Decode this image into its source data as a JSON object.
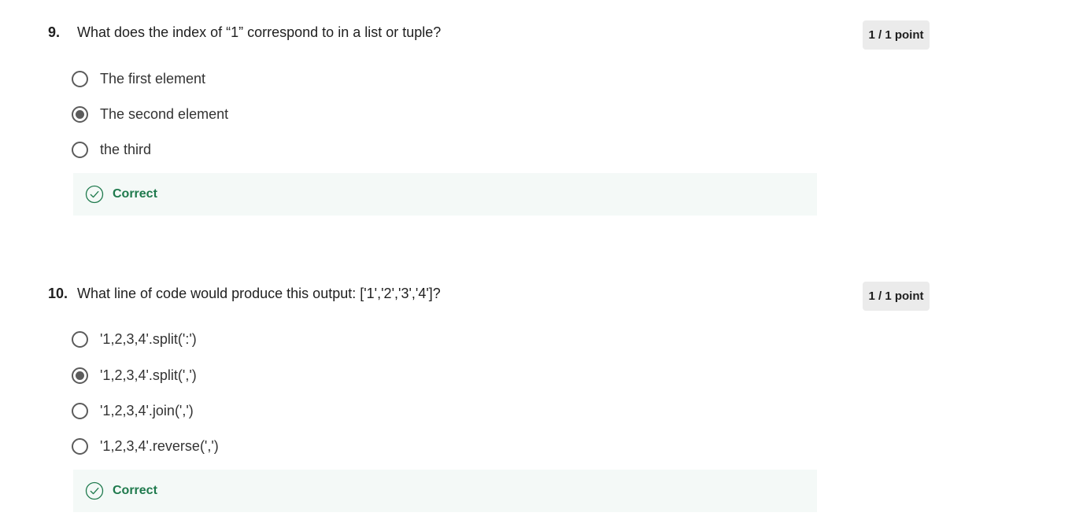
{
  "questions": [
    {
      "number": "9.",
      "text": "What does the index of “1” correspond to in a list or tuple?",
      "points": "1 / 1 point",
      "options": [
        {
          "label": "The first element",
          "selected": false
        },
        {
          "label": "The second element",
          "selected": true
        },
        {
          "label": "the third",
          "selected": false
        }
      ],
      "feedback": "Correct"
    },
    {
      "number": "10.",
      "text": "What line of code would produce this output: ['1','2','3','4']?",
      "points": "1 / 1 point",
      "options": [
        {
          "label": "'1,2,3,4'.split(':')",
          "selected": false
        },
        {
          "label": "'1,2,3,4'.split(',')",
          "selected": true
        },
        {
          "label": "'1,2,3,4'.join(',')",
          "selected": false
        },
        {
          "label": "'1,2,3,4'.reverse(',')",
          "selected": false
        }
      ],
      "feedback": "Correct"
    }
  ],
  "colors": {
    "feedback_text": "#1f7a4d",
    "feedback_bg": "#f4f9f7",
    "badge_bg": "#ebebeb",
    "radio": "#5b5b5b"
  },
  "icons": {
    "feedback": "check-circle-icon"
  }
}
